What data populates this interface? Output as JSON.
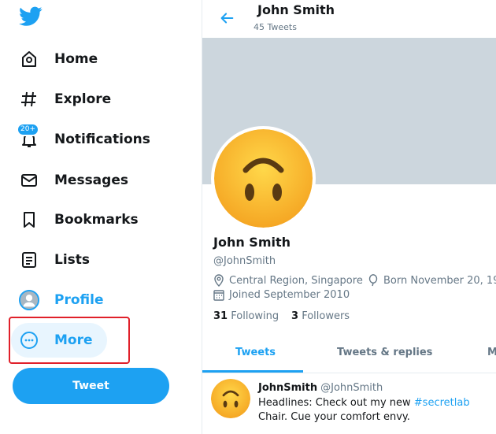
{
  "sidebar": {
    "logo_icon": "twitter-bird-icon",
    "items": [
      {
        "label": "Home",
        "icon": "home-icon"
      },
      {
        "label": "Explore",
        "icon": "hashtag-icon"
      },
      {
        "label": "Notifications",
        "icon": "bell-icon",
        "badge": "20+"
      },
      {
        "label": "Messages",
        "icon": "envelope-icon"
      },
      {
        "label": "Bookmarks",
        "icon": "bookmark-icon"
      },
      {
        "label": "Lists",
        "icon": "list-icon"
      },
      {
        "label": "Profile",
        "icon": "avatar-icon"
      },
      {
        "label": "More",
        "icon": "more-icon"
      }
    ],
    "tweet_button": "Tweet"
  },
  "header": {
    "name": "John Smith",
    "tweet_count": "45 Tweets"
  },
  "profile": {
    "name": "John Smith",
    "handle": "@JohnSmith",
    "location": "Central Region, Singapore",
    "born": "Born November 20, 19",
    "joined": "Joined September 2010",
    "following_count": "31",
    "following_label": "Following",
    "followers_count": "3",
    "followers_label": "Followers"
  },
  "tabs": [
    "Tweets",
    "Tweets & replies",
    "M"
  ],
  "tweet": {
    "name": "JohnSmith",
    "handle": "@JohnSmith",
    "text_before": "Headlines: Check out my new ",
    "hashtag": "#secretlab",
    "text_after": " Chair. Cue your comfort envy."
  },
  "colors": {
    "accent": "#1da1f2",
    "banner": "#ccd6dd",
    "highlight_box": "#e0202a"
  }
}
